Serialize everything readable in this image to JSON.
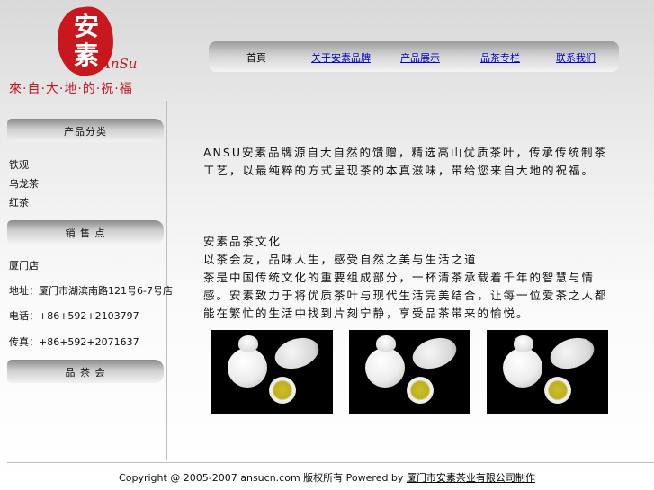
{
  "logo": {
    "seal_text": "安素",
    "script_text": "AnSu",
    "tagline": "來·自·大·地·的·祝·福"
  },
  "markers": {
    "m1": "",
    "m2": "",
    "m3": "",
    "m4": "",
    "m5": "",
    "m6": ""
  },
  "nav": {
    "start_marker": "",
    "home": "首頁",
    "items": [
      "关于安素品牌",
      "产品展示",
      "品茶专栏",
      "联系我们"
    ],
    "end_marker": ""
  },
  "sidebar": {
    "category_header": "产品分类",
    "categories": [
      "铁观",
      "乌龙茶",
      "红茶"
    ],
    "sales_header": "销 售 点",
    "sales_lines": [
      "厦门店",
      "地址：厦门市湖滨南路121号6-7号店",
      "电话：+86+592+2103797",
      "传真：+86+592+2071637"
    ],
    "tasting_header": "品 茶 会"
  },
  "main": {
    "intro": "ANSU安素品牌源自大自然的馈赠，精选高山优质茶叶，传承传统制茶工艺，以最纯粹的方式呈现茶的本真滋味，带给您来自大地的祝福。",
    "section_title": "安素品茶文化",
    "section_subtitle": "以茶会友，品味人生，感受自然之美与生活之道",
    "section_body": "茶是中国传统文化的重要组成部分，一杯清茶承载着千年的智慧与情感。安素致力于将优质茶叶与现代生活完美结合，让每一位爱茶之人都能在繁忙的生活中找到片刻宁静，享受品茶带来的愉悦。",
    "photos": [
      "tea-set-photo-1",
      "tea-set-photo-2",
      "tea-set-photo-3"
    ]
  },
  "footer": {
    "copyright": "Copyright @ 2005-2007 ansucn.com",
    "rights": "版权所有",
    "powered": "Powered by",
    "company": "厦门市安素茶业有限公司制作"
  },
  "colors": {
    "brand_red": "#c8171e",
    "link_blue": "#0000cc"
  }
}
